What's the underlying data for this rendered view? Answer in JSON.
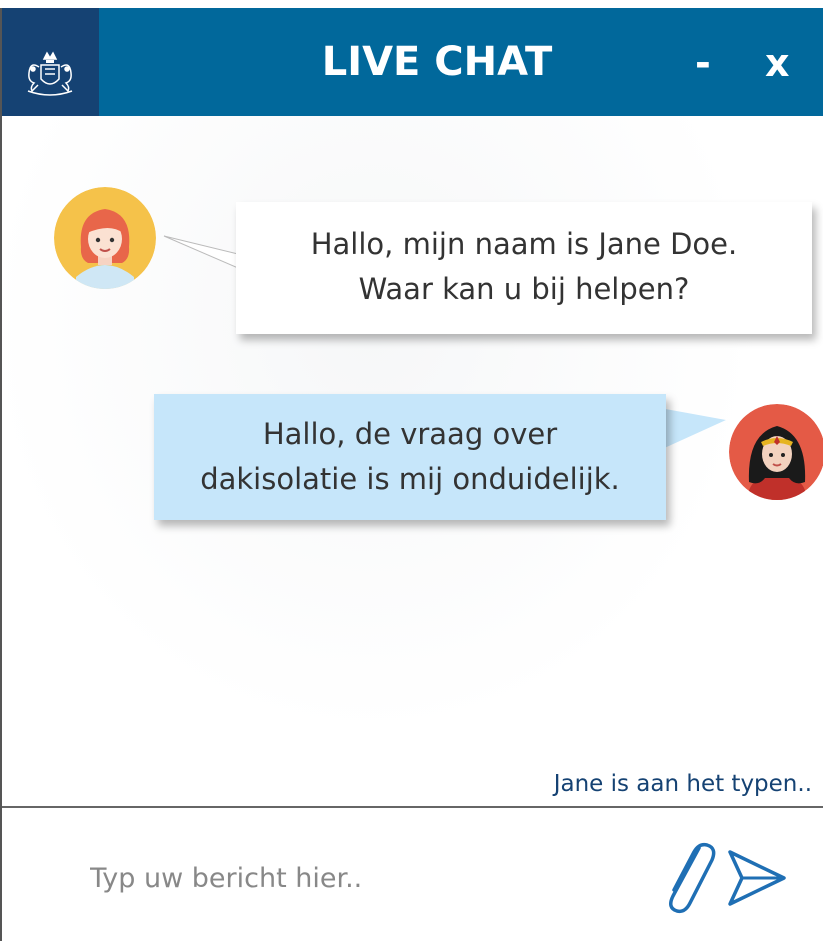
{
  "header": {
    "title": "LIVE CHAT",
    "minimize_label": "-",
    "close_label": "x",
    "logo_icon": "royal-coat-of-arms-icon",
    "background_color": "#01689b",
    "logo_background_color": "#154273"
  },
  "messages": [
    {
      "sender": "agent",
      "avatar_icon": "agent-avatar-icon",
      "lines": [
        "Hallo, mijn naam is Jane Doe.",
        "Waar kan u bij helpen?"
      ],
      "bubble_color": "#ffffff"
    },
    {
      "sender": "user",
      "avatar_icon": "user-avatar-icon",
      "lines": [
        "Hallo, de vraag over",
        "dakisolatie is mij onduidelijk."
      ],
      "bubble_color": "#c6e6fa"
    }
  ],
  "typing_indicator": "Jane is aan het typen..",
  "composer": {
    "placeholder": "Typ uw bericht hier..",
    "value": "",
    "attach_icon": "paperclip-icon",
    "send_icon": "send-arrow-icon",
    "icon_color": "#1f6fb4"
  }
}
